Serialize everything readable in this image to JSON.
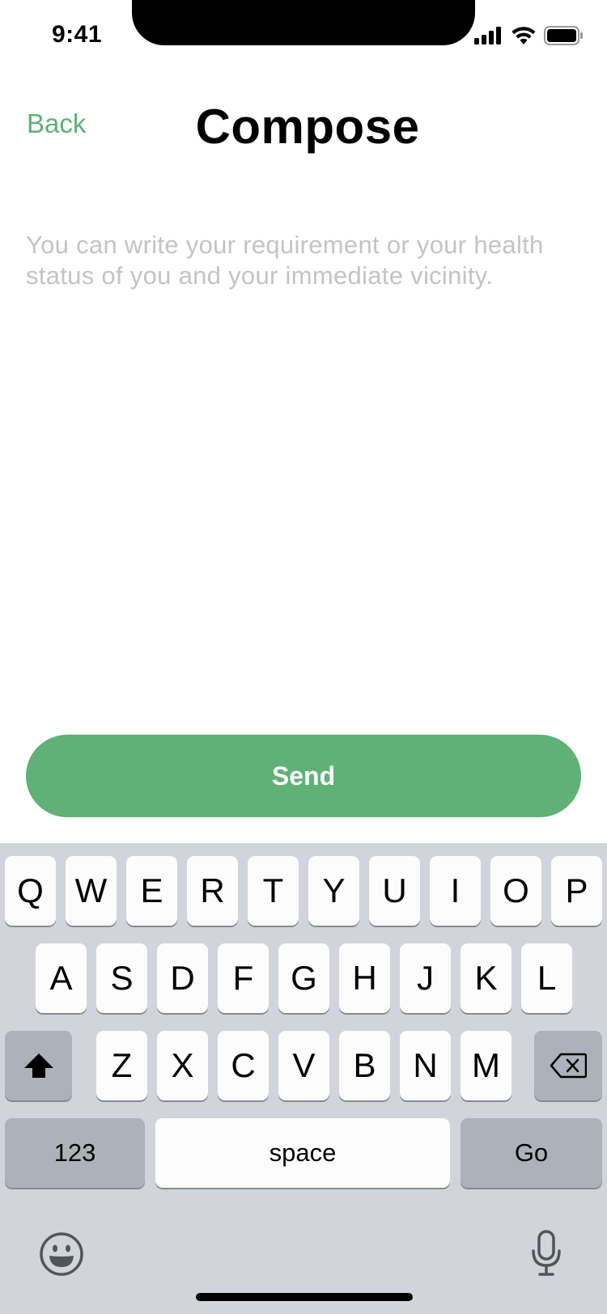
{
  "status_bar": {
    "time": "9:41"
  },
  "nav": {
    "back_label": "Back",
    "title": "Compose"
  },
  "compose": {
    "placeholder": "You can write your requirement or your health status of you and your immediate vicinity."
  },
  "send_label": "Send",
  "keyboard": {
    "row1": [
      "Q",
      "W",
      "E",
      "R",
      "T",
      "Y",
      "U",
      "I",
      "O",
      "P"
    ],
    "row2": [
      "A",
      "S",
      "D",
      "F",
      "G",
      "H",
      "J",
      "K",
      "L"
    ],
    "row3": [
      "Z",
      "X",
      "C",
      "V",
      "B",
      "N",
      "M"
    ],
    "numbers_label": "123",
    "space_label": "space",
    "go_label": "Go",
    "icons": [
      "shift-icon",
      "backspace-icon",
      "emoji-icon",
      "microphone-icon"
    ]
  },
  "colors": {
    "accent": "#5fb177",
    "placeholder": "#c4c4c4",
    "keyboard_bg": "#d1d4da",
    "key_bg": "#fcfcfd",
    "key_dark_bg": "#acb1ba"
  }
}
